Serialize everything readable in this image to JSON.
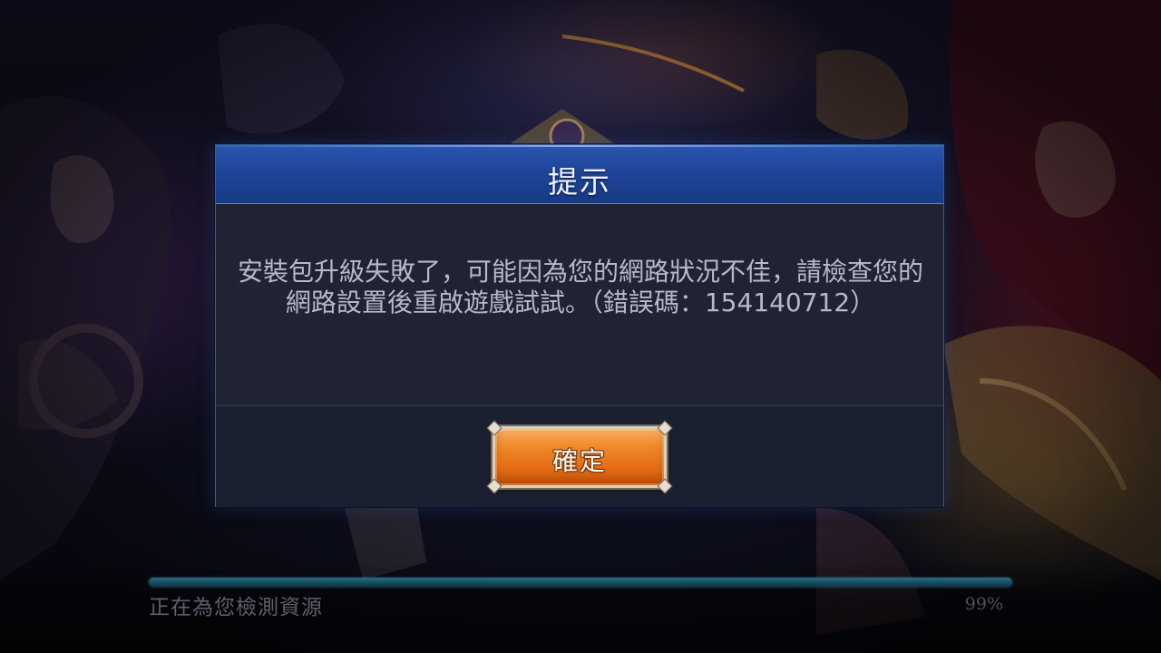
{
  "dialog": {
    "title": "提示",
    "message": "安裝包升級失敗了，可能因為您的網路狀況不佳，請檢查您的網路設置後重啟遊戲試試。（錯誤碼：154140712）",
    "confirm_label": "確定"
  },
  "loading": {
    "status_text": "正在為您檢測資源",
    "percent_text": "99%",
    "progress": 1.0
  },
  "colors": {
    "header_blue": "#1f459a",
    "body_bg": "#1f2332",
    "button_orange": "#f08a2a",
    "progress_teal": "#2a6f84"
  }
}
